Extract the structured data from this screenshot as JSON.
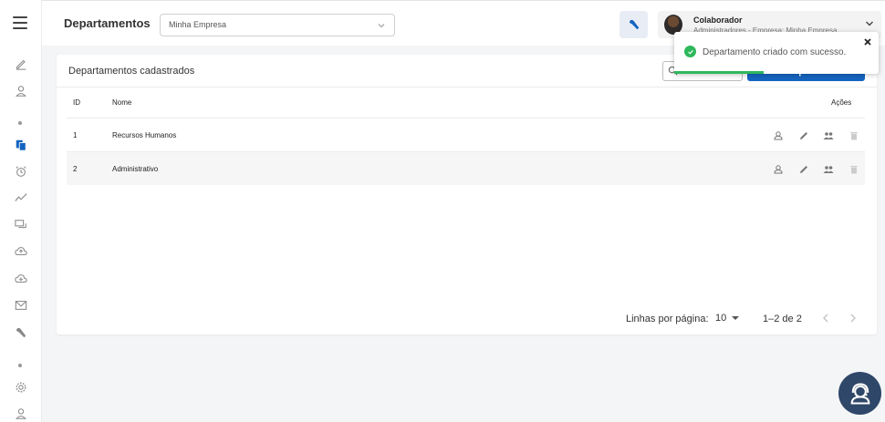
{
  "header": {
    "title": "Departamentos",
    "company_select": {
      "value": "Minha Empresa"
    },
    "user": {
      "name": "Colaborador",
      "role": "Administradores - Empresa: Minha Empresa"
    }
  },
  "sidebar": {
    "items": [
      {
        "icon": "edit-icon"
      },
      {
        "icon": "user-icon"
      },
      {
        "icon": "documents-icon",
        "active": true
      },
      {
        "icon": "alarm-icon"
      },
      {
        "icon": "chart-line-icon"
      },
      {
        "icon": "chat-icon"
      },
      {
        "icon": "cloud-upload-icon"
      },
      {
        "icon": "cloud-download-icon"
      },
      {
        "icon": "mail-icon"
      },
      {
        "icon": "wrench-icon"
      },
      {
        "icon": "settings-icon"
      },
      {
        "icon": "profile-icon"
      }
    ],
    "active_color": "#1565c0"
  },
  "card": {
    "title": "Departamentos cadastrados",
    "search_label": "Filtrar",
    "new_button": "Novo departamento",
    "columns": {
      "id": "ID",
      "name": "Nome",
      "actions": "Ações"
    },
    "rows": [
      {
        "id": "1",
        "name": "Recursos Humanos"
      },
      {
        "id": "2",
        "name": "Administrativo"
      }
    ]
  },
  "pagination": {
    "rows_per_page_label": "Linhas por página:",
    "rows_per_page": "10",
    "range": "1–2 de 2"
  },
  "toast": {
    "message": "Departamento criado com sucesso.",
    "color": "#2eb85c"
  },
  "colors": {
    "primary": "#1565c0",
    "support": "#2f4768"
  }
}
